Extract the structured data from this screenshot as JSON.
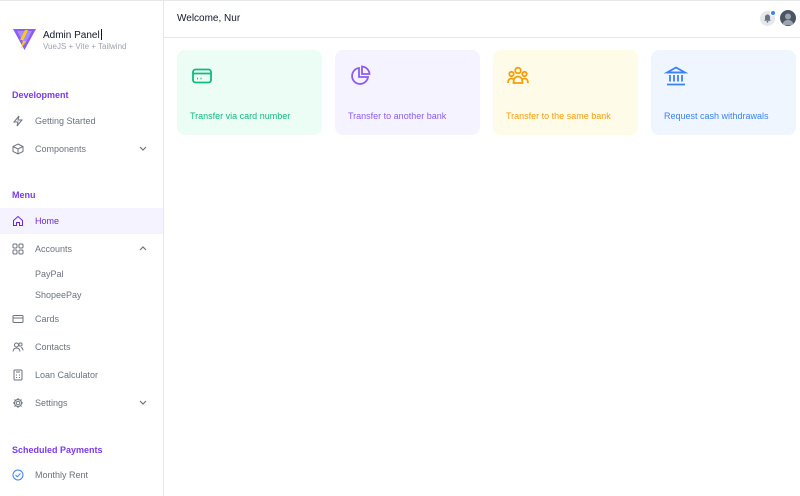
{
  "brand": {
    "title": "Admin Panel",
    "subtitle": "VueJS + Vite + Tailwind"
  },
  "sidebar": {
    "sections": [
      {
        "label": "Development",
        "items": [
          {
            "label": "Getting Started",
            "icon": "bolt-icon"
          },
          {
            "label": "Components",
            "icon": "cube-icon",
            "chevron": "down"
          }
        ]
      },
      {
        "label": "Menu",
        "items": [
          {
            "label": "Home",
            "icon": "home-icon",
            "active": true
          },
          {
            "label": "Accounts",
            "icon": "grid-icon",
            "chevron": "up",
            "children": [
              "PayPal",
              "ShopeePay"
            ]
          },
          {
            "label": "Cards",
            "icon": "credit-card-icon"
          },
          {
            "label": "Contacts",
            "icon": "users-icon"
          },
          {
            "label": "Loan Calculator",
            "icon": "calculator-icon"
          },
          {
            "label": "Settings",
            "icon": "gear-icon",
            "chevron": "down"
          }
        ]
      },
      {
        "label": "Scheduled Payments",
        "items": [
          {
            "label": "Monthly Rent",
            "icon": "check-circle-icon"
          }
        ]
      }
    ]
  },
  "header": {
    "welcome": "Welcome, Nur"
  },
  "cards": [
    {
      "label": "Transfer via card number",
      "icon": "credit-card-icon",
      "bg": "#ecfdf5",
      "color": "#10b981"
    },
    {
      "label": "Transfer to another bank",
      "icon": "pie-chart-icon",
      "bg": "#f5f3ff",
      "color": "#8b5cf6"
    },
    {
      "label": "Transfer to the same bank",
      "icon": "user-group-icon",
      "bg": "#fefce8",
      "color": "#f59e0b"
    },
    {
      "label": "Request cash withdrawals",
      "icon": "bank-icon",
      "bg": "#eff6ff",
      "color": "#3b82f6"
    }
  ],
  "colors": {
    "accent": "#7c3aed",
    "active_bg": "#f5f3ff",
    "notification_dot": "#3b82f6"
  }
}
